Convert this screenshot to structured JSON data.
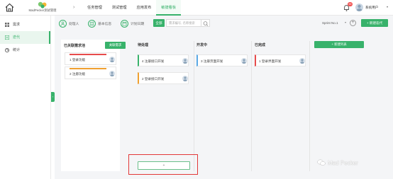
{
  "header": {
    "brand_name": "MadPecker测试管理",
    "nav": [
      {
        "label": "任务管理",
        "active": false
      },
      {
        "label": "测试管理",
        "active": false
      },
      {
        "label": "应用发布",
        "active": false
      },
      {
        "label": "敏捷看板",
        "active": true
      }
    ],
    "notification_count": "99",
    "user_name": "系统用户"
  },
  "sidebar": {
    "items": [
      {
        "label": "需求",
        "icon": "grid-icon",
        "active": false
      },
      {
        "label": "迭代",
        "icon": "iteration-icon",
        "active": true
      },
      {
        "label": "统计",
        "icon": "chart-icon",
        "active": false
      }
    ]
  },
  "toolbar": {
    "handler_label": "处理人",
    "basic_info_label": "基本信息",
    "plan_date_label": "计划日期",
    "view_label": "全部",
    "search_placeholder": "需求编号, 名称搜索",
    "sprint_label": "Sprint No.1",
    "new_iteration_label": "+ 新建迭代"
  },
  "backlog": {
    "title": "已关联需求池",
    "assoc_button": "关联需求",
    "cards": [
      {
        "label": "1 登录功能"
      },
      {
        "label": "2 注册功能"
      }
    ]
  },
  "columns": [
    {
      "title": "待处理",
      "cards": [
        {
          "label": "4 注册接口开发",
          "accent": "#38b26b"
        },
        {
          "label": "2 登录接口开发",
          "accent": "#f0a030"
        }
      ]
    },
    {
      "title": "开发中",
      "cards": [
        {
          "label": "3 注册页面开发",
          "accent": "#5aa9e6"
        }
      ]
    },
    {
      "title": "已完成",
      "cards": [
        {
          "label": "1 登录界面开发",
          "accent": "#e74c4c"
        }
      ]
    }
  ],
  "new_list_label": "+ 新建列表",
  "add_card_label": "+",
  "watermark": "Mad Pecker",
  "colors": {
    "accent": "#38b26b",
    "highlight": "#e23838"
  }
}
